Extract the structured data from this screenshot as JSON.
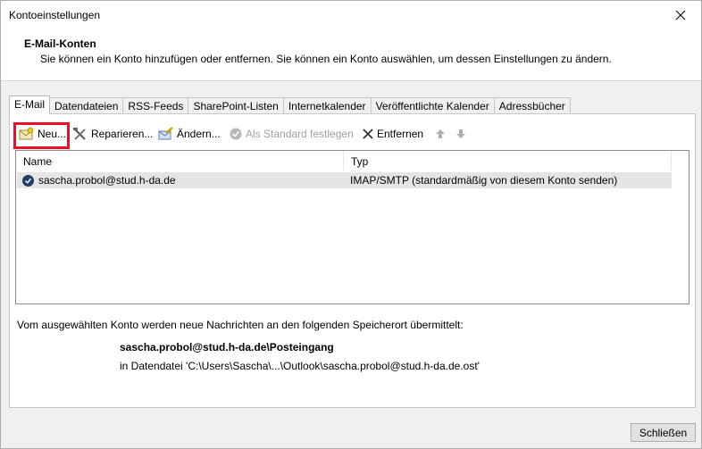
{
  "window": {
    "title": "Kontoeinstellungen",
    "close_icon": "close-icon"
  },
  "header": {
    "title": "E-Mail-Konten",
    "subtitle": "Sie können ein Konto hinzufügen oder entfernen. Sie können ein Konto auswählen, um dessen Einstellungen zu ändern."
  },
  "tabs": [
    {
      "label": "E-Mail",
      "active": true
    },
    {
      "label": "Datendateien",
      "active": false
    },
    {
      "label": "RSS-Feeds",
      "active": false
    },
    {
      "label": "SharePoint-Listen",
      "active": false
    },
    {
      "label": "Internetkalender",
      "active": false
    },
    {
      "label": "Veröffentlichte Kalender",
      "active": false
    },
    {
      "label": "Adressbücher",
      "active": false
    }
  ],
  "toolbar": {
    "new_label": "Neu...",
    "repair_label": "Reparieren...",
    "change_label": "Ändern...",
    "set_default_label": "Als Standard festlegen",
    "remove_label": "Entfernen",
    "highlight_color": "#e81123"
  },
  "list": {
    "columns": [
      "Name",
      "Typ"
    ],
    "rows": [
      {
        "name": "sascha.probol@stud.h-da.de",
        "type": "IMAP/SMTP (standardmäßig von diesem Konto senden)",
        "selected": true
      }
    ]
  },
  "info": {
    "text": "Vom ausgewählten Konto werden neue Nachrichten an den folgenden Speicherort übermittelt:",
    "location": "sascha.probol@stud.h-da.de\\Posteingang",
    "file": "in Datendatei 'C:\\Users\\Sascha\\...\\Outlook\\sascha.probol@stud.h-da.de.ost'"
  },
  "footer": {
    "close_label": "Schließen"
  }
}
